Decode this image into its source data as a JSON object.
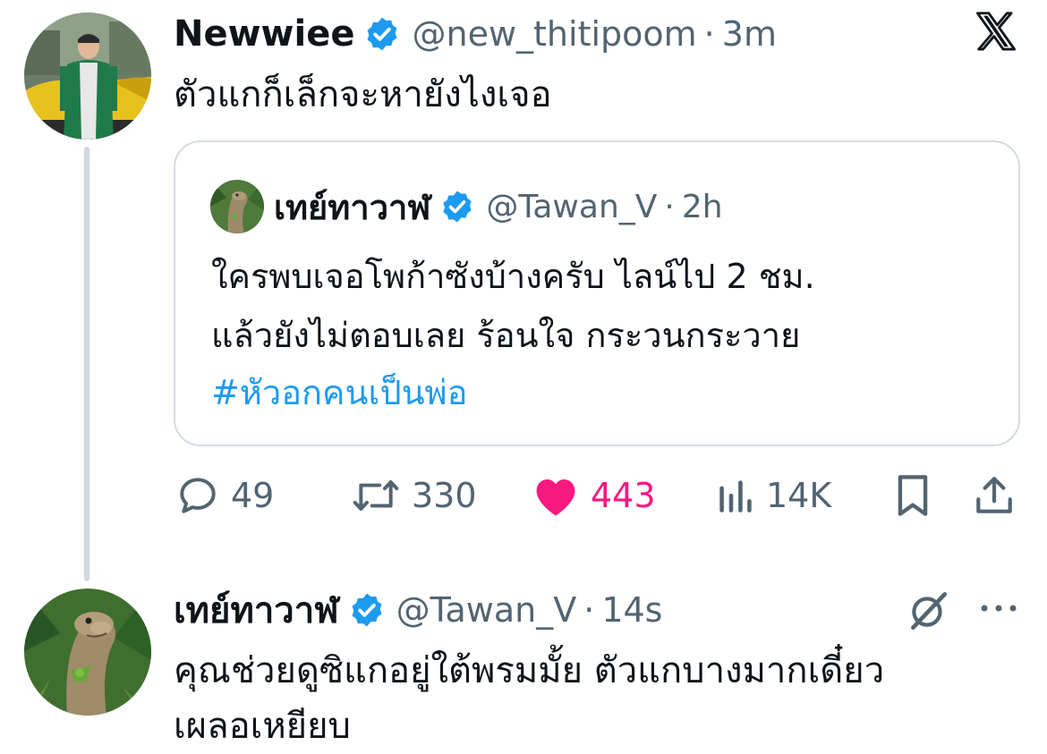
{
  "main_tweet": {
    "display_name": "Newwiee",
    "handle": "@new_thitipoom",
    "separator": "·",
    "time": "3m",
    "text": "ตัวแกก็เล็กจะหายังไงเจอ",
    "avatar_icon": "person-photo-avatar",
    "verified_icon": "verified-badge-icon",
    "verified_color": "#1d9bf0"
  },
  "quoted_tweet": {
    "display_name": "เทย์ทาวาฬ",
    "handle": "@Tawan_V",
    "separator": "·",
    "time": "2h",
    "line1": "ใครพบเจอโพก้าซังบ้างครับ ไลน์ไป 2 ชม.",
    "line2": "แล้วยังไม่ตอบเลย ร้อนใจ กระวนกระวาย",
    "hashtag": "#หัวอกคนเป็นพ่อ",
    "hashtag_color": "#1d9bf0",
    "avatar_icon": "dinosaur-avatar"
  },
  "actions": {
    "replies": "49",
    "reposts": "330",
    "likes": "443",
    "views": "14K",
    "like_color": "#f91880",
    "icons": [
      "reply-icon",
      "repost-icon",
      "like-icon",
      "views-icon",
      "bookmark-icon",
      "share-icon"
    ]
  },
  "reply_tweet": {
    "display_name": "เทย์ทาวาฬ",
    "handle": "@Tawan_V",
    "separator": "·",
    "time": "14s",
    "line1": "คุณช่วยดูซิแกอยู่ใต้พรมมั้ย ตัวแกบางมากเดี๋ยว",
    "line2": "เผลอเหยียบ",
    "avatar_icon": "dinosaur-avatar",
    "grok_icon": "grok-icon",
    "more_icon": "more-options-icon"
  },
  "brand": {
    "logo_icon": "x-logo-icon"
  }
}
